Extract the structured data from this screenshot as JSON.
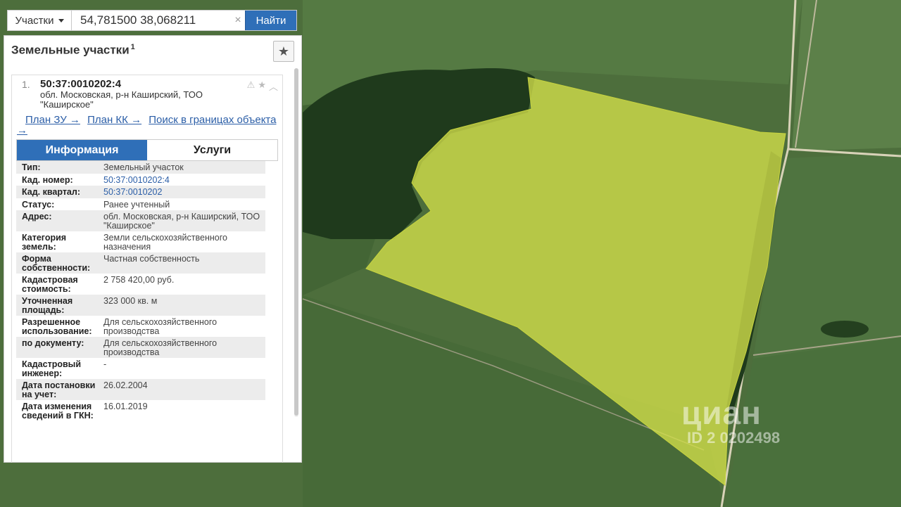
{
  "search": {
    "layer_label": "Участки",
    "value": "54,781500 38,068211",
    "clear_icon": "×",
    "find_label": "Найти"
  },
  "panel": {
    "title": "Земельные участки",
    "count": "1",
    "fav_icon": "★"
  },
  "result": {
    "number": "1.",
    "cad_number": "50:37:0010202:4",
    "address": "обл. Московская, р-н Каширский, ТОО \"Каширское\"",
    "links": [
      "План ЗУ →",
      "План КК →",
      "Поиск в границах объекта →"
    ],
    "tabs": [
      "Информация",
      "Услуги"
    ],
    "active_tab": "Информация",
    "attributes": [
      {
        "key": "Тип:",
        "value": "Земельный участок"
      },
      {
        "key": "Кад. номер:",
        "value": "50:37:0010202:4",
        "link": true
      },
      {
        "key": "Кад. квартал:",
        "value": "50:37:0010202",
        "link": true
      },
      {
        "key": "Статус:",
        "value": "Ранее учтенный"
      },
      {
        "key": "Адрес:",
        "value": "обл. Московская, р-н Каширский, ТОО \"Каширское\""
      },
      {
        "key": "Категория земель:",
        "value": "Земли сельскохозяйственного назначения"
      },
      {
        "key": "Форма собственности:",
        "value": "Частная собственность"
      },
      {
        "key": "Кадастровая стоимость:",
        "value": "2 758 420,00 руб."
      },
      {
        "key": "Уточненная площадь:",
        "value": "323 000 кв. м"
      },
      {
        "key": "Разрешенное использование:",
        "value": "Для сельскохозяйственного производства"
      },
      {
        "key": "по документу:",
        "value": "Для сельскохозяйственного производства"
      },
      {
        "key": "Кадастровый инженер:",
        "value": "-"
      },
      {
        "key": "Дата постановки на учет:",
        "value": "26.02.2004"
      },
      {
        "key": "Дата изменения сведений в ГКН:",
        "value": "16.01.2019"
      }
    ]
  },
  "watermark": {
    "brand": "циан",
    "id": "ID 2 0202498"
  },
  "colors": {
    "accent": "#2f6fb8",
    "parcel_fill": "#d4e04a",
    "field": "#4d6e3c",
    "forest": "#1f3a1c"
  }
}
